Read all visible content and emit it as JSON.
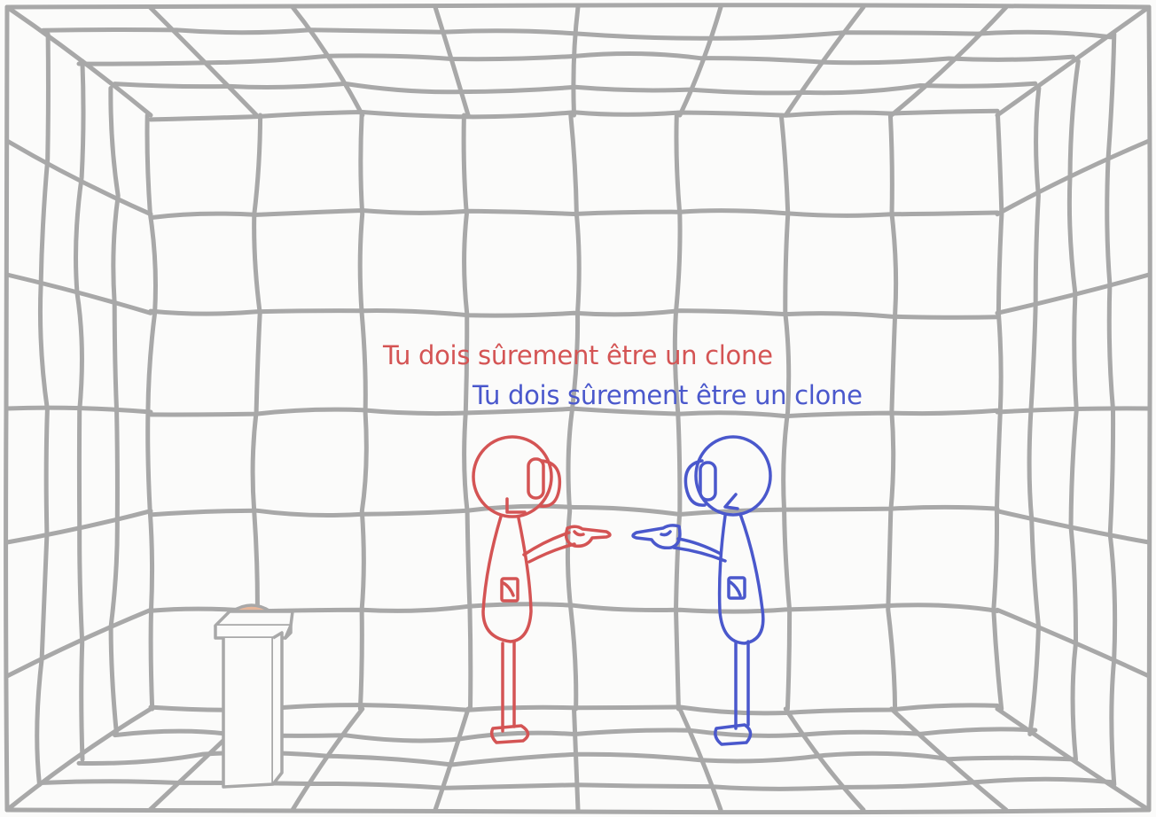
{
  "colors": {
    "wall_lines": "#a8a8a8",
    "background": "#fbfbfa",
    "red_character": "#d45454",
    "blue_character": "#4a58cc",
    "button": "#e7b69a"
  },
  "dialogue": {
    "red_line": "Tu dois sûrement être un clone",
    "blue_line": "Tu dois sûrement être un clone"
  },
  "objects": {
    "room": "padded-room",
    "pedestal": "button-pedestal",
    "characters": [
      "red-stick-figure",
      "blue-stick-figure"
    ]
  }
}
